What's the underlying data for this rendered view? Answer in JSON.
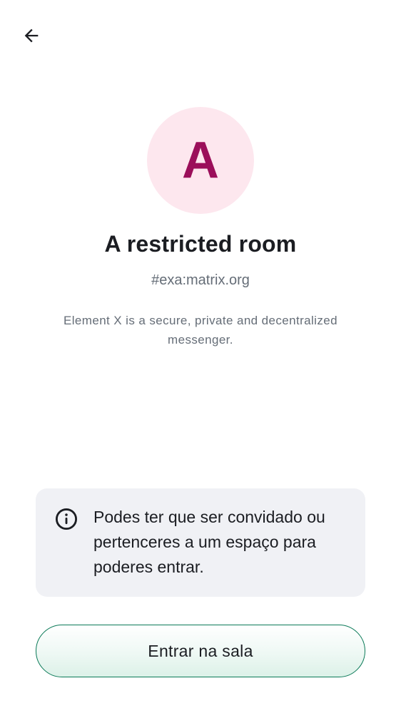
{
  "header": {
    "back_icon": "arrow-left-icon"
  },
  "room": {
    "avatar_letter": "A",
    "avatar_bg": "#fde7ee",
    "avatar_fg": "#9b0f5a",
    "title": "A restricted room",
    "alias": "#exa:matrix.org",
    "description": "Element X is a secure, private and decentralized messenger."
  },
  "notice": {
    "icon": "info-icon",
    "text": "Podes ter que ser convidado ou pertenceres a um espaço para poderes entrar.",
    "bg": "#f0f1f5"
  },
  "actions": {
    "join_label": "Entrar na sala",
    "accent": "#0b7a58"
  }
}
